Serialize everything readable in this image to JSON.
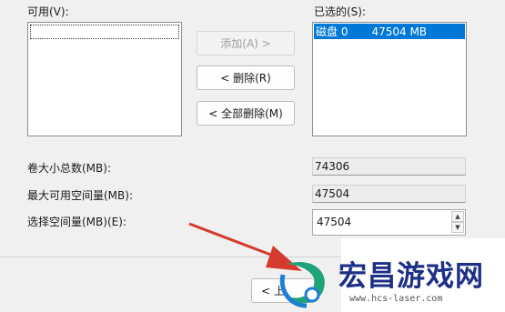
{
  "labels": {
    "available": "可用(V):",
    "selected": "已选的(S):",
    "volume_total": "卷大小总数(MB):",
    "max_available": "最大可用空间量(MB):",
    "select_space": "选择空间量(MB)(E):"
  },
  "selected_list": {
    "items": [
      {
        "name": "磁盘 0",
        "size": "47504 MB"
      }
    ]
  },
  "buttons": {
    "add": "添加(A) >",
    "remove": "< 删除(R)",
    "remove_all": "< 全部删除(M)",
    "back_partial": "< 上"
  },
  "values": {
    "volume_total": "74306",
    "max_available": "47504",
    "select_space": "47504"
  },
  "watermark": {
    "text": "宏昌游戏网",
    "url": "www.hcs-laser.com"
  },
  "colors": {
    "selection": "#0078d7",
    "annotation_arrow": "#d63a2f",
    "watermark_text": "#1d2f86"
  }
}
